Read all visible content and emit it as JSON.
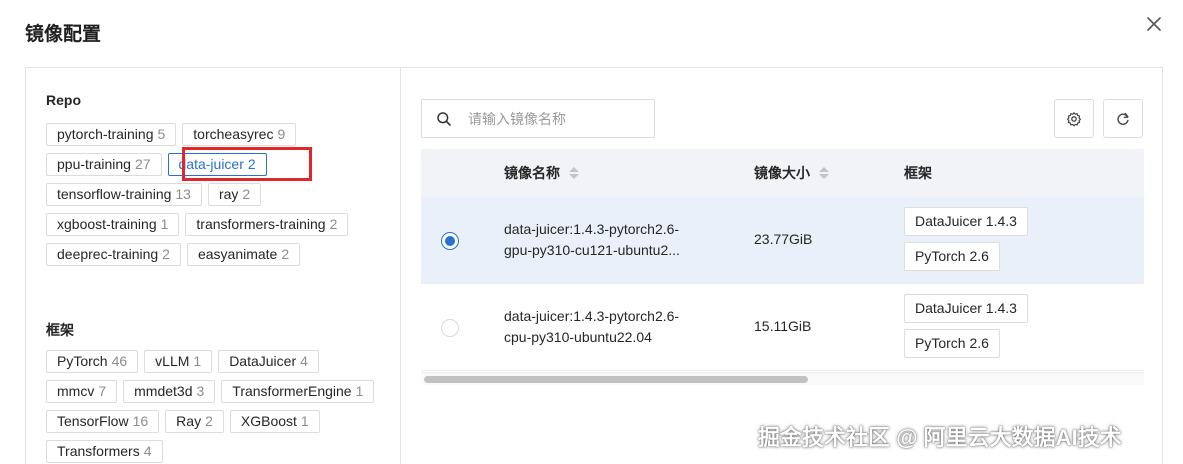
{
  "modal": {
    "title": "镜像配置"
  },
  "filters": {
    "repo": {
      "title": "Repo",
      "items": [
        {
          "label": "pytorch-training",
          "count": "5"
        },
        {
          "label": "torcheasyrec",
          "count": "9"
        },
        {
          "label": "ppu-training",
          "count": "27"
        },
        {
          "label": "data-juicer",
          "count": "2"
        },
        {
          "label": "tensorflow-training",
          "count": "13"
        },
        {
          "label": "ray",
          "count": "2"
        },
        {
          "label": "xgboost-training",
          "count": "1"
        },
        {
          "label": "transformers-training",
          "count": "2"
        },
        {
          "label": "deeprec-training",
          "count": "2"
        },
        {
          "label": "easyanimate",
          "count": "2"
        }
      ]
    },
    "framework": {
      "title": "框架",
      "items": [
        {
          "label": "PyTorch",
          "count": "46"
        },
        {
          "label": "vLLM",
          "count": "1"
        },
        {
          "label": "DataJuicer",
          "count": "4"
        },
        {
          "label": "mmcv",
          "count": "7"
        },
        {
          "label": "mmdet3d",
          "count": "3"
        },
        {
          "label": "TransformerEngine",
          "count": "1"
        },
        {
          "label": "TensorFlow",
          "count": "16"
        },
        {
          "label": "Ray",
          "count": "2"
        },
        {
          "label": "XGBoost",
          "count": "1"
        },
        {
          "label": "Transformers",
          "count": "4"
        }
      ]
    }
  },
  "search": {
    "placeholder": "请输入镜像名称",
    "value": ""
  },
  "table": {
    "columns": {
      "name": "镜像名称",
      "size": "镜像大小",
      "framework": "框架"
    },
    "rows": [
      {
        "name_line1": "data-juicer:1.4.3-pytorch2.6-",
        "name_line2": "gpu-py310-cu121-ubuntu2...",
        "size": "23.77GiB",
        "frameworks": [
          "DataJuicer 1.4.3",
          "PyTorch 2.6"
        ],
        "selected": true
      },
      {
        "name_line1": "data-juicer:1.4.3-pytorch2.6-",
        "name_line2": "cpu-py310-ubuntu22.04",
        "size": "15.11GiB",
        "frameworks": [
          "DataJuicer 1.4.3",
          "PyTorch 2.6"
        ],
        "selected": false
      }
    ]
  },
  "watermark": "掘金技术社区 @ 阿里云大数据AI技术",
  "colors": {
    "accent": "#2770d6",
    "highlight": "#e3262a",
    "selected_row": "#eaf0f9",
    "header_bg": "#f1f3f7"
  }
}
